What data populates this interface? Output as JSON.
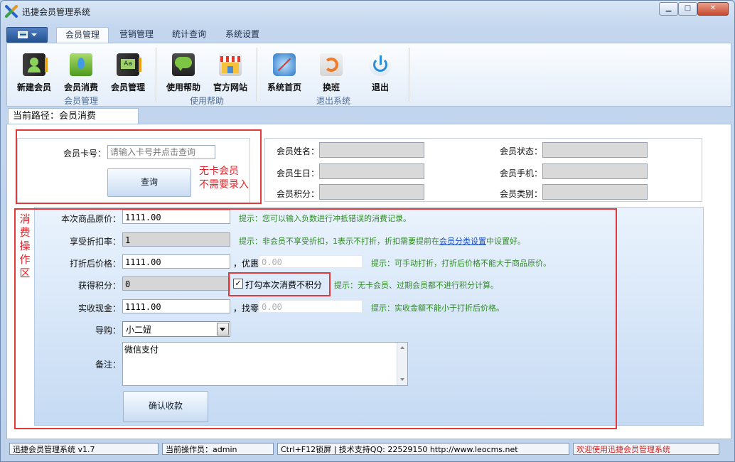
{
  "window": {
    "title": "迅捷会员管理系统",
    "min_label": "▁",
    "max_label": "□",
    "close_label": "✕"
  },
  "menu_tabs": [
    {
      "label": "会员管理",
      "active": true
    },
    {
      "label": "营销管理",
      "active": false
    },
    {
      "label": "统计查询",
      "active": false
    },
    {
      "label": "系统设置",
      "active": false
    }
  ],
  "ribbon": {
    "buttons": [
      {
        "label": "新建会员",
        "icon": "member-add-icon"
      },
      {
        "label": "会员消费",
        "icon": "member-consume-icon"
      },
      {
        "label": "会员管理",
        "icon": "member-manage-icon"
      },
      {
        "label": "使用帮助",
        "icon": "help-chat-icon"
      },
      {
        "label": "官方网站",
        "icon": "store-icon"
      },
      {
        "label": "系统首页",
        "icon": "compass-icon"
      },
      {
        "label": "换班",
        "icon": "shift-swap-icon"
      },
      {
        "label": "退出",
        "icon": "power-icon"
      }
    ],
    "groups": [
      "会员管理",
      "使用帮助",
      "退出系统"
    ]
  },
  "path": {
    "text": "当前路径：会员消费"
  },
  "card_query": {
    "label": "会员卡号：",
    "placeholder": "请输入卡号并点击查询",
    "query_button": "查询",
    "note_line1": "无卡会员",
    "note_line2": "不需要录入"
  },
  "member_info": {
    "name_label": "会员姓名：",
    "birthday_label": "会员生日：",
    "points_label": "会员积分：",
    "status_label": "会员状态：",
    "phone_label": "会员手机：",
    "category_label": "会员类别："
  },
  "operation_area": {
    "side_label": [
      "消",
      "费",
      "操",
      "作",
      "区"
    ],
    "original_price_label": "本次商品原价：",
    "original_price": "1111.00",
    "original_price_hint": "提示：您可以输入负数进行冲抵错误的消费记录。",
    "discount_label": "享受折扣率：",
    "discount": "1",
    "discount_hint_prefix": "提示：非会员不享受折扣，1表示不打折，折扣需要提前在",
    "discount_hint_link": "会员分类设置",
    "discount_hint_suffix": "中设置好。",
    "discounted_price_label": "打折后价格：",
    "discounted_price": "1111.00",
    "coupon_label": "，优惠",
    "coupon_value": "0.00",
    "discounted_price_hint": "提示：可手动打折，打折后价格不能大于商品原价。",
    "earned_points_label": "获得积分：",
    "earned_points": "0",
    "no_points_checkbox": "打勾本次消费不积分",
    "no_points_checked": true,
    "earned_points_hint": "提示：无卡会员、过期会员都不进行积分计算。",
    "cash_label": "实收现金：",
    "cash": "1111.00",
    "change_label": "，找零",
    "change_value": "0.00",
    "cash_hint": "提示：实收金额不能小于打折后价格。",
    "guide_label": "导购：",
    "guide_value": "小二妞",
    "remark_label": "备注：",
    "remark_value": "微信支付",
    "confirm_button": "确认收款"
  },
  "status_bar": {
    "version": "迅捷会员管理系统 v1.7",
    "operator": "当前操作员：admin",
    "support": "Ctrl+F12锁屏 | 技术支持QQ:  22529150       http://www.leocms.net",
    "welcome": "欢迎使用迅捷会员管理系统"
  },
  "colors": {
    "accent_red": "#e23a3a",
    "hint_green": "#2e8b22",
    "link_blue": "#1a4fc4"
  }
}
